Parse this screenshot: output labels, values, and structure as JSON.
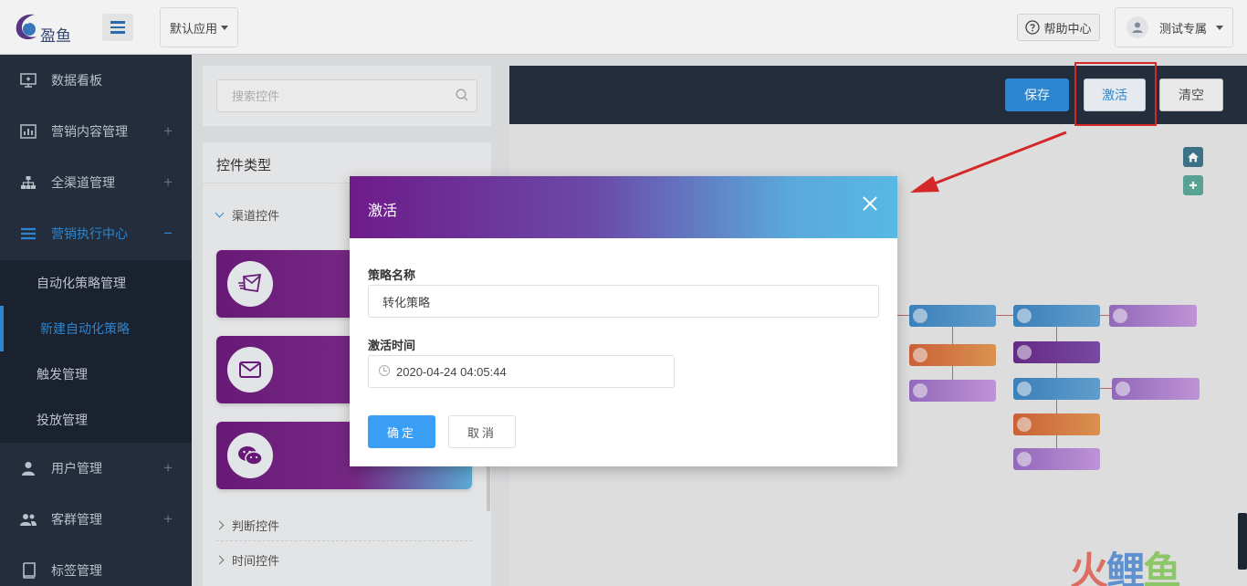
{
  "header": {
    "logo_text": "盈鱼",
    "app_select": "默认应用",
    "help": "帮助中心",
    "user": "测试专属"
  },
  "sidebar": {
    "items": [
      {
        "label": "数据看板",
        "icon": "monitor-icon"
      },
      {
        "label": "营销内容管理",
        "icon": "bar-chart-icon"
      },
      {
        "label": "全渠道管理",
        "icon": "sitemap-icon"
      },
      {
        "label": "营销执行中心",
        "icon": "list-icon"
      },
      {
        "label": "用户管理",
        "icon": "user-icon"
      },
      {
        "label": "客群管理",
        "icon": "users-icon"
      },
      {
        "label": "标签管理",
        "icon": "book-icon"
      }
    ],
    "submenu": [
      "自动化策略管理",
      "新建自动化策略",
      "触发管理",
      "投放管理"
    ],
    "active_item": "营销执行中心",
    "active_sub": "新建自动化策略",
    "expand_symbol": "+",
    "collapse_symbol": "−"
  },
  "controls": {
    "search_placeholder": "搜索控件",
    "title": "控件类型",
    "groups": [
      "渠道控件",
      "判断控件",
      "时间控件"
    ],
    "cards": [
      "sms-icon",
      "email-icon",
      "wechat-icon"
    ]
  },
  "canvas": {
    "save": "保存",
    "activate": "激活",
    "clear": "清空"
  },
  "modal": {
    "title": "激活",
    "name_label": "策略名称",
    "name_value": "转化策略",
    "time_label": "激活时间",
    "time_value": "2020-04-24 04:05:44",
    "ok": "确定",
    "cancel": "取消"
  },
  "watermark": {
    "part1": "火",
    "part2": "鲤",
    "part3": "鱼"
  },
  "colors": {
    "accent": "#2f8ddb",
    "sidebar": "#263040",
    "highlight": "#e02a2a"
  }
}
